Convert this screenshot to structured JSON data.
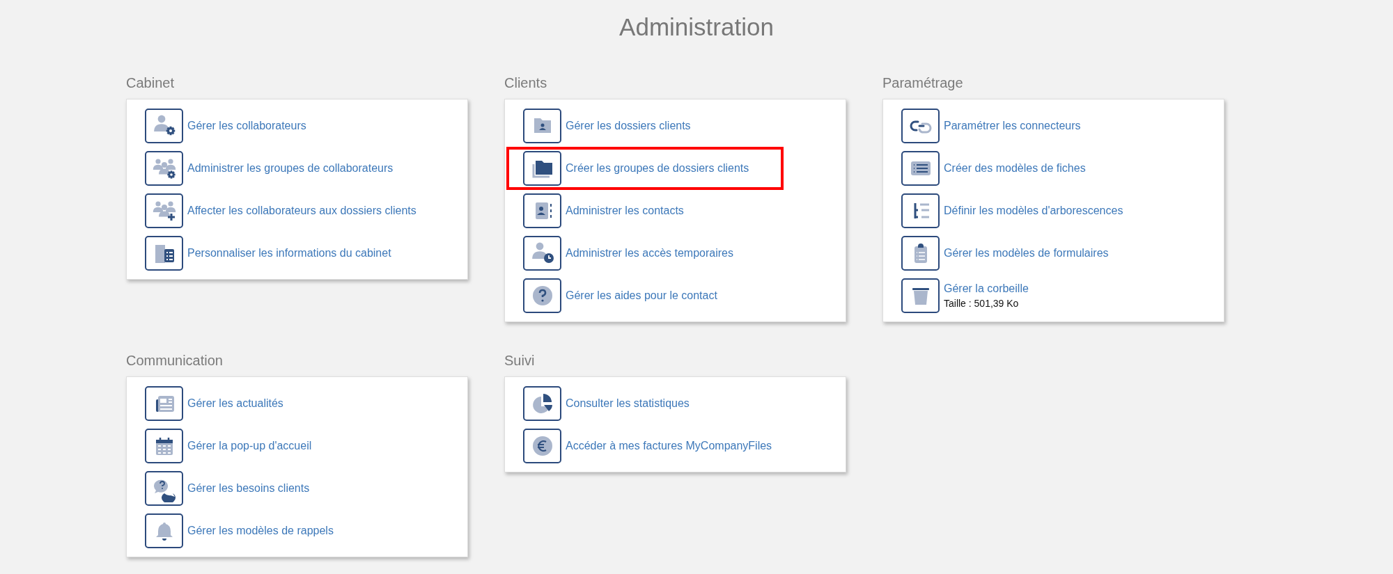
{
  "title": "Administration",
  "sections": [
    {
      "heading": "Cabinet",
      "items": [
        {
          "label": "Gérer les collaborateurs",
          "highlighted": false
        },
        {
          "label": "Administrer les groupes de collaborateurs",
          "highlighted": false
        },
        {
          "label": "Affecter les collaborateurs aux dossiers clients",
          "highlighted": false
        },
        {
          "label": "Personnaliser les informations du cabinet",
          "highlighted": false
        }
      ]
    },
    {
      "heading": "Clients",
      "items": [
        {
          "label": "Gérer les dossiers clients",
          "highlighted": false
        },
        {
          "label": "Créer les groupes de dossiers clients",
          "highlighted": true
        },
        {
          "label": "Administrer les contacts",
          "highlighted": false
        },
        {
          "label": "Administrer les accès temporaires",
          "highlighted": false
        },
        {
          "label": "Gérer les aides pour le contact",
          "highlighted": false
        }
      ]
    },
    {
      "heading": "Paramétrage",
      "items": [
        {
          "label": "Paramétrer les connecteurs",
          "highlighted": false
        },
        {
          "label": "Créer des modèles de fiches",
          "highlighted": false
        },
        {
          "label": "Définir les modèles d'arborescences",
          "highlighted": false
        },
        {
          "label": "Gérer les modèles de formulaires",
          "highlighted": false
        },
        {
          "label": "Gérer la corbeille",
          "detail": "Taille : 501,39 Ko",
          "highlighted": false
        }
      ]
    },
    {
      "heading": "Communication",
      "items": [
        {
          "label": "Gérer les actualités",
          "highlighted": false
        },
        {
          "label": "Gérer la pop-up d'accueil",
          "highlighted": false
        },
        {
          "label": "Gérer les besoins clients",
          "highlighted": false
        },
        {
          "label": "Gérer les modèles de rappels",
          "highlighted": false
        }
      ]
    },
    {
      "heading": "Suivi",
      "items": [
        {
          "label": "Consulter les statistiques",
          "highlighted": false
        },
        {
          "label": "Accéder à mes factures MyCompanyFiles",
          "highlighted": false
        }
      ]
    }
  ]
}
